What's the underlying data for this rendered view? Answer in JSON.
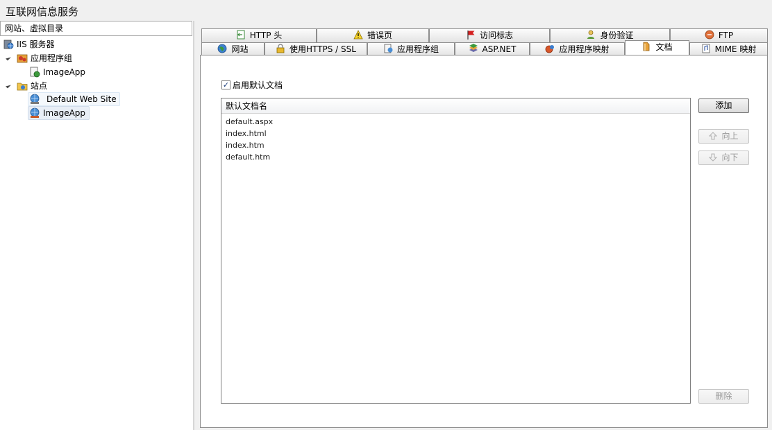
{
  "window": {
    "title": "互联网信息服务"
  },
  "left": {
    "header": "网站、虚拟目录",
    "tree": [
      {
        "label": "IIS 服务器",
        "icon": "server-icon",
        "level": 0
      },
      {
        "label": "应用程序组",
        "icon": "app-pool-icon",
        "level": 1,
        "expanded": true
      },
      {
        "label": "ImageApp",
        "icon": "app-icon",
        "level": 2
      },
      {
        "label": "站点",
        "icon": "sites-folder-icon",
        "level": 1,
        "expanded": true
      },
      {
        "label": "Default Web Site",
        "icon": "web-site-icon",
        "level": 2
      },
      {
        "label": "ImageApp",
        "icon": "web-app-icon",
        "level": 2,
        "selected": true
      }
    ]
  },
  "tabs": {
    "row_back": [
      {
        "label": "HTTP 头",
        "icon": "http-header-icon"
      },
      {
        "label": "错误页",
        "icon": "warning-icon"
      },
      {
        "label": "访问标志",
        "icon": "flag-icon"
      },
      {
        "label": "身份验证",
        "icon": "key-user-icon"
      },
      {
        "label": "FTP",
        "icon": "ftp-icon"
      }
    ],
    "row_front": [
      {
        "label": "网站",
        "icon": "globe-icon"
      },
      {
        "label": "使用HTTPS / SSL",
        "icon": "lock-icon"
      },
      {
        "label": "应用程序组",
        "icon": "app-pool-icon"
      },
      {
        "label": "ASP.NET",
        "icon": "aspnet-icon"
      },
      {
        "label": "应用程序映射",
        "icon": "mapping-icon"
      },
      {
        "label": "文档",
        "icon": "document-icon",
        "active": true
      },
      {
        "label": "MIME 映射",
        "icon": "mime-icon"
      }
    ]
  },
  "documents": {
    "enable_label": "启用默认文档",
    "enabled": true,
    "column_header": "默认文档名",
    "items": [
      "default.aspx",
      "index.html",
      "index.htm",
      "default.htm"
    ],
    "buttons": {
      "add": "添加",
      "up": "向上",
      "down": "向下",
      "delete": "删除"
    }
  },
  "colors": {
    "tab_border": "#8d8d8d",
    "selection": "#f4f8fc",
    "disabled_text": "#9a9a9a"
  }
}
